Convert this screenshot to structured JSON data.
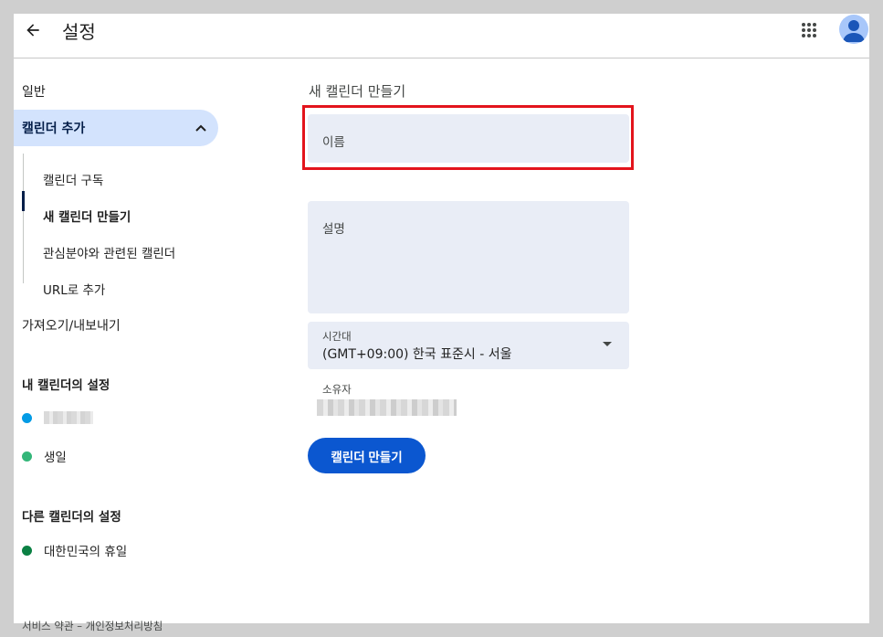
{
  "header": {
    "title": "설정",
    "back_icon": "arrow-left-icon",
    "apps_icon": "apps-grid-icon",
    "avatar_icon": "account-avatar-icon"
  },
  "sidebar": {
    "general": "일반",
    "add_calendar": "캘린더 추가",
    "add_calendar_expanded": true,
    "sub_items": [
      {
        "label": "캘린더 구독",
        "active": false
      },
      {
        "label": "새 캘린더 만들기",
        "active": true
      },
      {
        "label": "관심분야와 관련된 캘린더",
        "active": false
      },
      {
        "label": "URL로 추가",
        "active": false
      }
    ],
    "import_export": "가져오기/내보내기",
    "my_calendars_heading": "내 캘린더의 설정",
    "my_calendars": [
      {
        "label": "",
        "color": "#039be5",
        "redacted": true
      },
      {
        "label": "생일",
        "color": "#33b679",
        "redacted": false
      }
    ],
    "other_calendars_heading": "다른 캘린더의 설정",
    "other_calendars": [
      {
        "label": "대한민국의 휴일",
        "color": "#0b8043"
      }
    ]
  },
  "main": {
    "title": "새 캘린더 만들기",
    "name_placeholder": "이름",
    "description_placeholder": "설명",
    "timezone_label": "시간대",
    "timezone_value": "(GMT+09:00) 한국 표준시 - 서울",
    "owner_label": "소유자",
    "create_button": "캘린더 만들기"
  },
  "footer": {
    "links": "서비스 약관 – 개인정보처리방침"
  },
  "colors": {
    "accent": "#0b57d0",
    "selected_nav": "#d3e3fd",
    "field_bg": "#e9edf6",
    "highlight": "#e3141c"
  }
}
